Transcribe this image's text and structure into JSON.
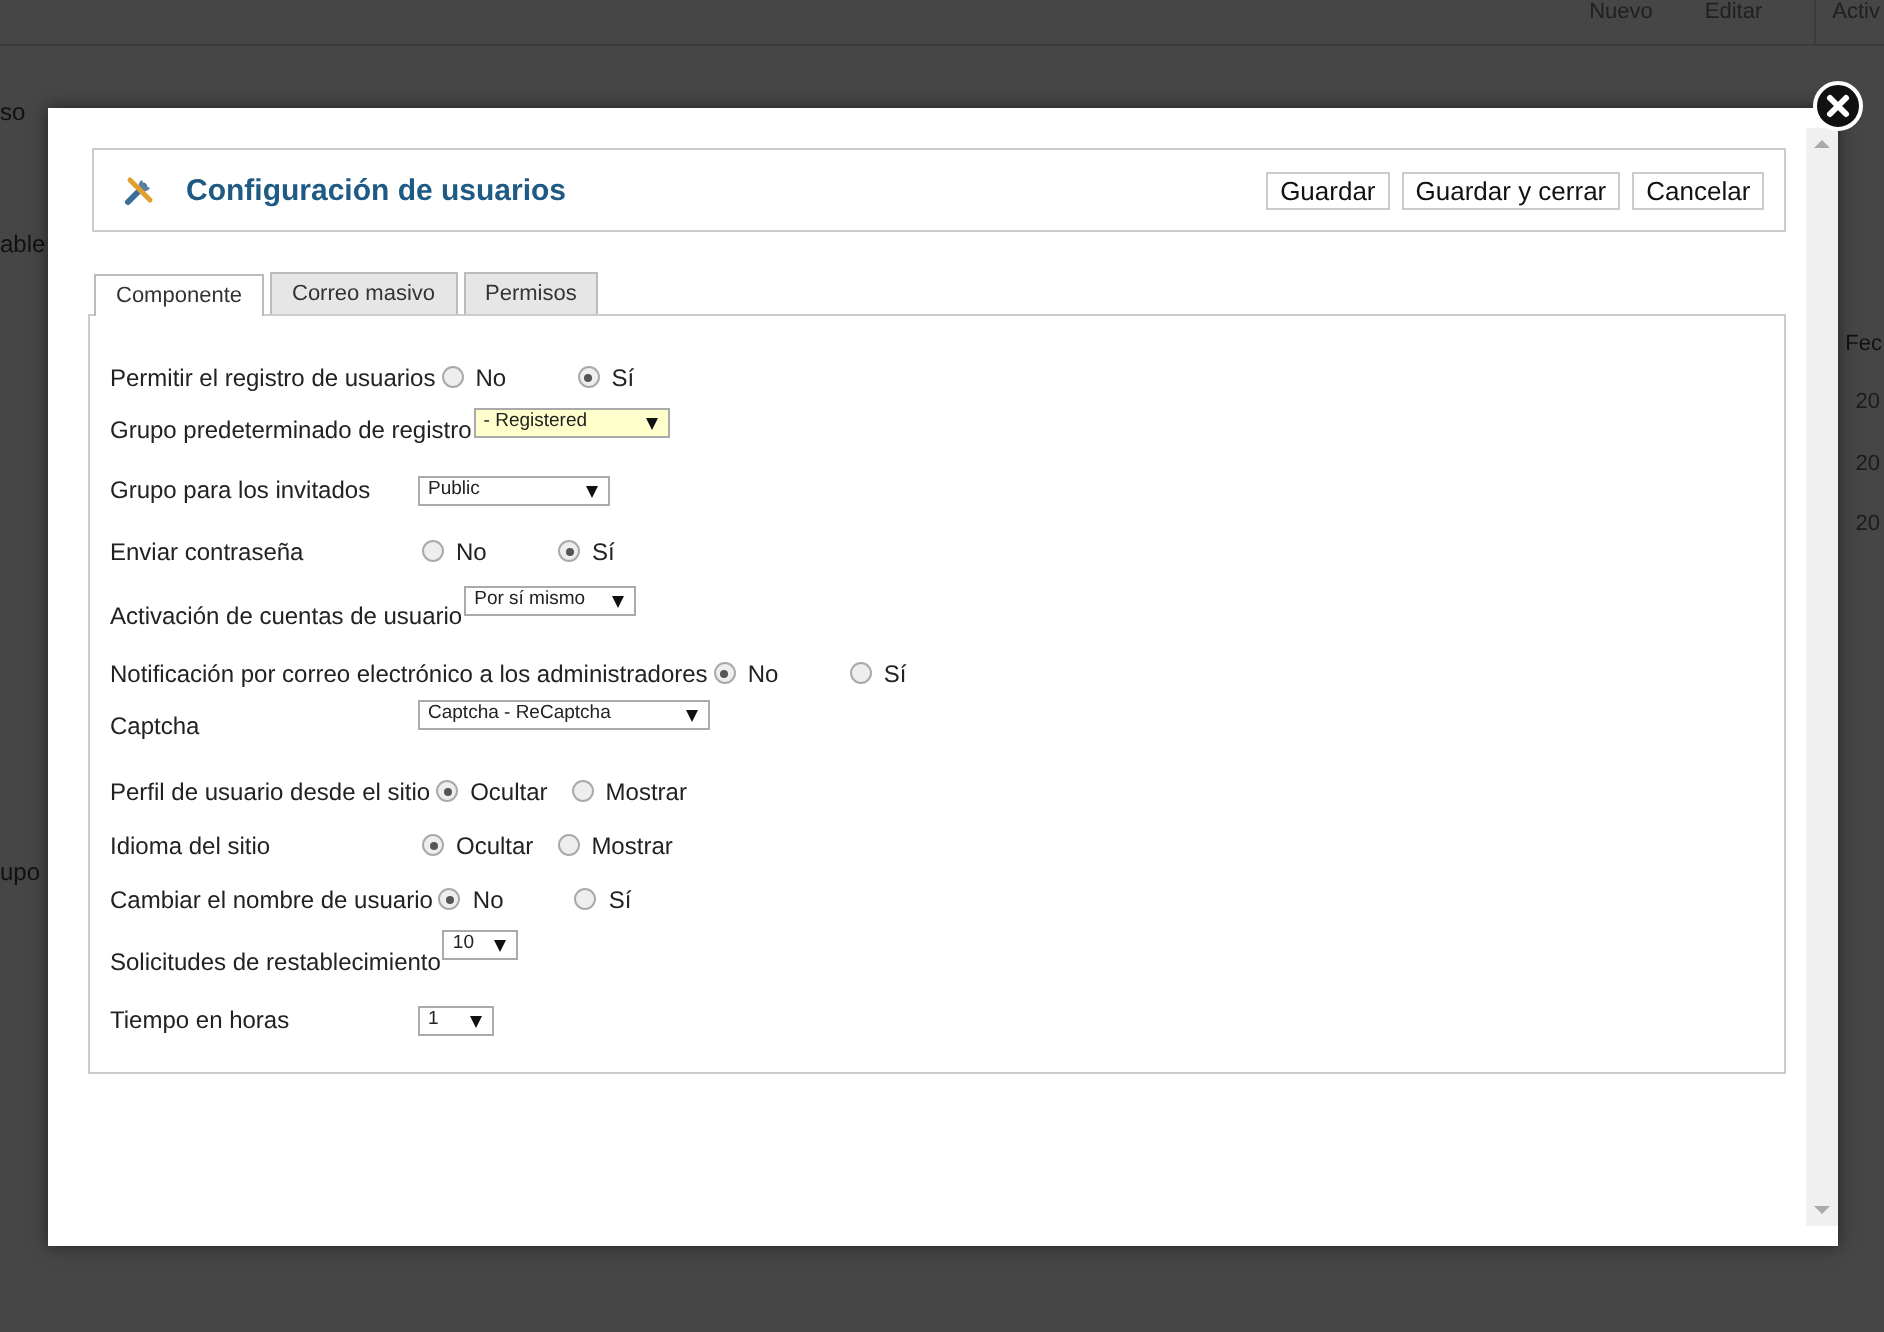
{
  "background": {
    "toolbar": [
      "Nuevo",
      "Editar",
      "Activ"
    ],
    "left_fragments": [
      "so",
      "able",
      "upo"
    ],
    "column_4": {
      "heading": "Fec",
      "cells": [
        "20",
        "20",
        "20"
      ]
    }
  },
  "modal": {
    "title": "Configuración de usuarios",
    "buttons": [
      "Guardar",
      "Guardar y cerrar",
      "Cancelar"
    ],
    "tabs": [
      {
        "label": "Componente",
        "selected": true
      },
      {
        "label": "Correo masivo",
        "selected": false
      },
      {
        "label": "Permisos",
        "selected": false
      }
    ],
    "fields": [
      {
        "kind": "radio",
        "label": "Permitir el registro de usuarios",
        "options": [
          {
            "label": "No",
            "selected": false
          },
          {
            "label": "Sí",
            "selected": true
          }
        ]
      },
      {
        "kind": "select",
        "label": "Grupo predeterminado de registro",
        "value": "- Registered",
        "focused": true
      },
      {
        "kind": "select",
        "label": "Grupo para los invitados",
        "value": "Public",
        "focused": false
      },
      {
        "kind": "radio",
        "label": "Enviar contraseña",
        "options": [
          {
            "label": "No",
            "selected": false
          },
          {
            "label": "Sí",
            "selected": true
          }
        ]
      },
      {
        "kind": "select",
        "label": "Activación de cuentas de usuario",
        "value": "Por sí mismo",
        "focused": false
      },
      {
        "kind": "radio",
        "label": "Notificación por correo electrónico a los administradores",
        "options": [
          {
            "label": "No",
            "selected": true
          },
          {
            "label": "Sí",
            "selected": false
          }
        ]
      },
      {
        "kind": "select",
        "label": "Captcha",
        "value": "Captcha - ReCaptcha",
        "focused": false
      },
      {
        "kind": "radio",
        "label": "Perfil de usuario desde el sitio",
        "options": [
          {
            "label": "Ocultar",
            "selected": true
          },
          {
            "label": "Mostrar",
            "selected": false
          }
        ]
      },
      {
        "kind": "radio",
        "label": "Idioma del sitio",
        "options": [
          {
            "label": "Ocultar",
            "selected": true
          },
          {
            "label": "Mostrar",
            "selected": false
          }
        ]
      },
      {
        "kind": "radio",
        "label": "Cambiar el nombre de usuario",
        "options": [
          {
            "label": "No",
            "selected": true
          },
          {
            "label": "Sí",
            "selected": false
          }
        ]
      },
      {
        "kind": "select",
        "label": "Solicitudes de restablecimiento",
        "value": "10",
        "focused": false
      },
      {
        "kind": "select",
        "label": "Tiempo en horas",
        "value": "1",
        "focused": false
      }
    ]
  }
}
